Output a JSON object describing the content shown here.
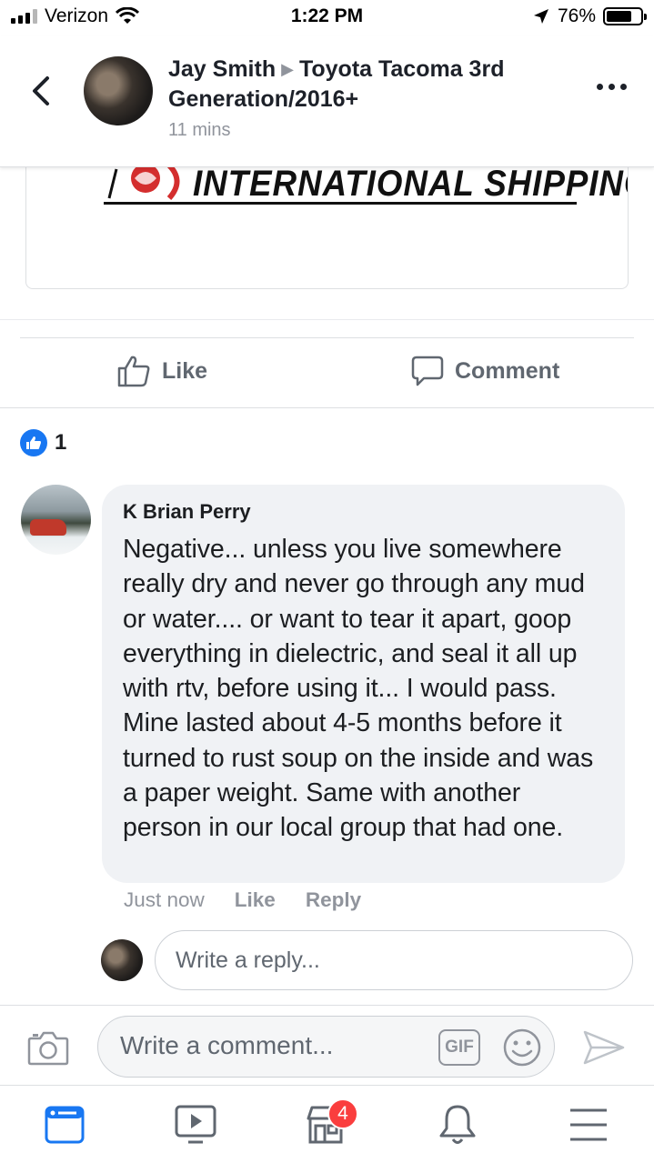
{
  "status_bar": {
    "carrier": "Verizon",
    "time": "1:22 PM",
    "battery": "76%",
    "battery_level": 0.76,
    "icons": [
      "signal-icon",
      "wifi-icon",
      "location-arrow-icon",
      "battery-icon"
    ]
  },
  "post_header": {
    "author": "Jay Smith",
    "group": "Toyota Tacoma 3rd Generation/2016+",
    "time": "11 mins"
  },
  "link_preview": {
    "logo_text": "INTERNATIONAL SHIPPING"
  },
  "actions": {
    "like_label": "Like",
    "comment_label": "Comment"
  },
  "reactions": {
    "count": "1"
  },
  "comment": {
    "author": "K Brian Perry",
    "text": "Negative... unless you live somewhere really dry and never go through any mud or water.... or want to tear it apart, goop everything in dielectric, and seal it all up with rtv, before using it... I would pass. Mine lasted about 4-5 months before it turned to rust soup on the inside and was a paper weight. Same with another person in our local group that had one.",
    "time": "Just now",
    "like_label": "Like",
    "reply_label": "Reply"
  },
  "reply_box": {
    "placeholder": "Write a reply..."
  },
  "composer": {
    "placeholder": "Write a comment...",
    "gif_label": "GIF"
  },
  "tab_bar": {
    "items": [
      {
        "name": "feed",
        "icon": "news-feed-icon",
        "active": true
      },
      {
        "name": "watch",
        "icon": "video-icon"
      },
      {
        "name": "marketplace",
        "icon": "marketplace-icon",
        "badge": "4"
      },
      {
        "name": "notifications",
        "icon": "bell-icon"
      },
      {
        "name": "menu",
        "icon": "menu-icon"
      }
    ]
  },
  "colors": {
    "accent": "#1877f2",
    "badge": "#fa3e3e",
    "muted": "#90949c"
  }
}
